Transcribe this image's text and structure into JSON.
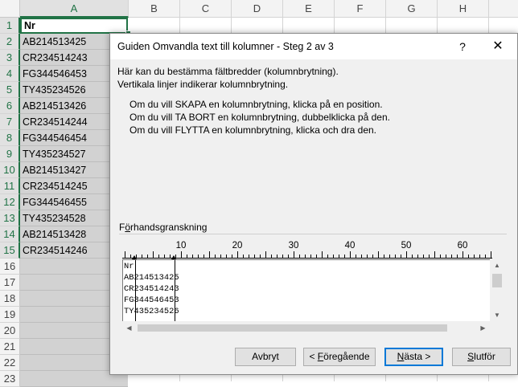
{
  "spreadsheet": {
    "columns": [
      "A",
      "B",
      "C",
      "D",
      "E",
      "F",
      "G",
      "H"
    ],
    "rows": [
      "1",
      "2",
      "3",
      "4",
      "5",
      "6",
      "7",
      "8",
      "9",
      "10",
      "11",
      "12",
      "13",
      "14",
      "15",
      "16",
      "17",
      "18",
      "19",
      "20",
      "21",
      "22",
      "23"
    ],
    "column_a": [
      "Nr",
      "AB214513425",
      "CR234514243",
      "FG344546453",
      "TY435234526",
      "AB214513426",
      "CR234514244",
      "FG344546454",
      "TY435234527",
      "AB214513427",
      "CR234514245",
      "FG344546455",
      "TY435234528",
      "AB214513428",
      "CR234514246"
    ]
  },
  "dialog": {
    "title": "Guiden Omvandla text till kolumner - Steg 2 av 3",
    "help_label": "?",
    "close_label": "✕",
    "intro_1": "Här kan du bestämma fältbredder (kolumnbrytning).",
    "intro_2": "Vertikala linjer indikerar kolumnbrytning.",
    "instr_1": "Om du vill SKAPA en kolumnbrytning, klicka på en position.",
    "instr_2": "Om du vill TA BORT en kolumnbrytning, dubbelklicka på den.",
    "instr_3": "Om du vill FLYTTA en kolumnbrytning, klicka och dra den.",
    "preview_label_pre": "F",
    "preview_label_acc": "ö",
    "preview_label_post": "rhandsgranskning",
    "ruler_labels": [
      "10",
      "20",
      "30",
      "40",
      "50",
      "60"
    ],
    "preview_lines": [
      "Nr",
      "AB214513425",
      "CR234514243",
      "FG344546453",
      "TY435234526"
    ],
    "buttons": {
      "cancel": "Avbryt",
      "back_pre": "< ",
      "back_acc": "F",
      "back_post": "öregående",
      "next_acc": "N",
      "next_post": "ästa >",
      "finish_acc": "S",
      "finish_post": "lutför"
    }
  },
  "colors": {
    "excel_green": "#217346",
    "dialog_bg": "#f0f0f0",
    "default_button_border": "#0078d7",
    "selected_column_bg": "#d2d2d2"
  }
}
